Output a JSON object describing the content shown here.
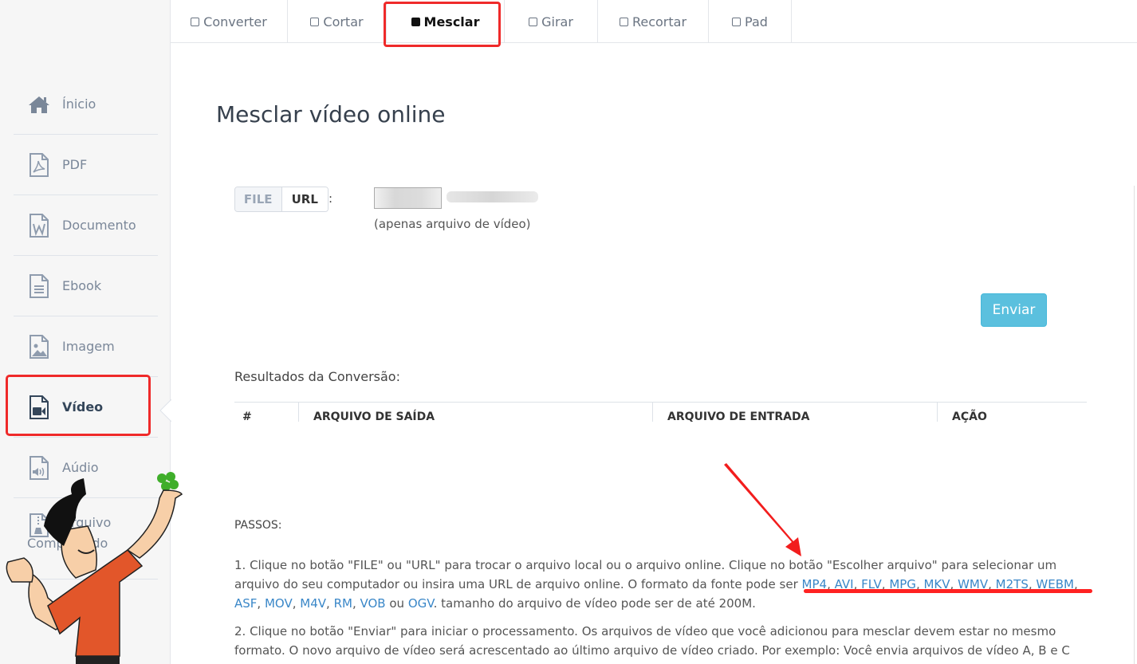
{
  "tabs": [
    {
      "label": "Converter",
      "active": false
    },
    {
      "label": "Cortar",
      "active": false
    },
    {
      "label": "Mesclar",
      "active": true
    },
    {
      "label": "Girar",
      "active": false
    },
    {
      "label": "Recortar",
      "active": false
    },
    {
      "label": "Pad",
      "active": false
    }
  ],
  "sidebar": {
    "items": [
      {
        "label": "Ínicio",
        "icon": "home-icon"
      },
      {
        "label": "PDF",
        "icon": "pdf-file-icon"
      },
      {
        "label": "Documento",
        "icon": "word-file-icon"
      },
      {
        "label": "Ebook",
        "icon": "text-file-icon"
      },
      {
        "label": "Imagem",
        "icon": "image-file-icon"
      },
      {
        "label": "Vídeo",
        "icon": "video-file-icon",
        "active": true
      },
      {
        "label": "Aúdio",
        "icon": "audio-file-icon"
      },
      {
        "label": "Arquivo",
        "label2": "Compactado",
        "icon": "zip-file-icon"
      }
    ]
  },
  "main": {
    "title": "Mesclar vídeo online",
    "source_toggle": {
      "file": "FILE",
      "url": "URL",
      "selected": "FILE"
    },
    "colon": ":",
    "hint": "(apenas arquivo de vídeo)",
    "send_label": "Enviar",
    "results_label": "Resultados da Conversão:",
    "table_headers": [
      "#",
      "ARQUIVO DE SAÍDA",
      "ARQUIVO DE ENTRADA",
      "AÇÃO"
    ],
    "steps_title": "PASSOS:",
    "step1": {
      "text_before": "1. Clique no botão \"FILE\" ou \"URL\" para trocar o arquivo local ou o arquivo online. Clique no botão \"Escolher arquivo\" para selecionar um arquivo do seu computador ou insira uma URL de arquivo online. O formato da fonte pode ser ",
      "formats": [
        "MP4",
        "AVI",
        "FLV",
        "MPG",
        "MKV",
        "WMV",
        "M2TS",
        "WEBM",
        "ASF",
        "MOV",
        "M4V",
        "RM",
        "VOB"
      ],
      "joiner": " ou ",
      "last_format": "OGV",
      "text_after": ". tamanho do arquivo de vídeo pode ser de até 200M."
    },
    "step2": "2. Clique no botão \"Enviar\" para iniciar o processamento. Os arquivos de vídeo que você adicionou para mesclar devem estar no mesmo formato. O novo arquivo de vídeo será acrescentado ao último arquivo de vídeo criado. Por exemplo: Você envia arquivos de vídeo A, B e C"
  },
  "colors": {
    "accent": "#5bc0de",
    "link": "#3a87c8",
    "annotation_red": "#ef2a2a"
  }
}
